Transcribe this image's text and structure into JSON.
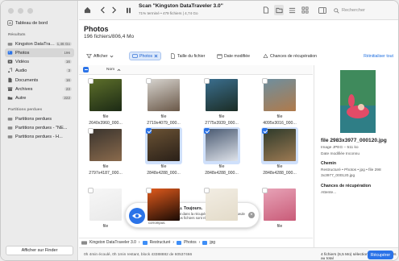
{
  "sidebar": {
    "dashboard_label": "Tableau de bord",
    "results_heading": "Résultats",
    "results": [
      {
        "label": "Kingston DataTraveler...",
        "count": "1,46 Go"
      },
      {
        "label": "Photos",
        "count": "196"
      },
      {
        "label": "Vidéos",
        "count": "16"
      },
      {
        "label": "Audio",
        "count": "3"
      },
      {
        "label": "Documents",
        "count": "16"
      },
      {
        "label": "Archives",
        "count": "23"
      },
      {
        "label": "Autre",
        "count": "222"
      }
    ],
    "lost_heading": "Partitions perdues",
    "lost": [
      {
        "label": "Partitions perdues"
      },
      {
        "label": "Partitions perdues - \"NE..."
      },
      {
        "label": "Partitions perdues - H..."
      }
    ],
    "finder_button": "Afficher sur Finder"
  },
  "toolbar": {
    "scan_title": "Scan \"Kingston DataTraveler 3.0\"",
    "scan_sub": "71% terminé • 479 fichiers | 4,74 Go",
    "search_placeholder": "Rechercher"
  },
  "header": {
    "title": "Photos",
    "subtitle": "196 fichiers/806,4 Mo"
  },
  "filters": {
    "show": "Afficher",
    "photos": "Photos",
    "file_size": "Taille du fichier",
    "date_modified": "Date modifiée",
    "recovery_chances": "Chances de récupération",
    "reset": "Réinitialiser tout"
  },
  "list": {
    "name_col": "Nom"
  },
  "grid": {
    "tiles": [
      {
        "line1": "",
        "line2": "file 2640x3960_000...",
        "checked": false,
        "selected": false,
        "focus": false,
        "c1": "#5d6f2a",
        "c2": "#1c2a15"
      },
      {
        "line1": "",
        "line2": "file 2719x4079_000...",
        "checked": false,
        "selected": false,
        "focus": false,
        "c1": "#d7d4cf",
        "c2": "#6a5848"
      },
      {
        "line1": "",
        "line2": "file 2775x3939_000...",
        "checked": false,
        "selected": false,
        "focus": false,
        "c1": "#3b6f8f",
        "c2": "#1b2c24"
      },
      {
        "line1": "",
        "line2": "file 4095x3016_000...",
        "checked": false,
        "selected": false,
        "focus": false,
        "c1": "#6e8f9f",
        "c2": "#b07a4a"
      },
      {
        "line1": "",
        "line2": "file 2797x4187_000...",
        "checked": false,
        "selected": false,
        "focus": false,
        "c1": "#3a342e",
        "c2": "#8a6a4c"
      },
      {
        "line1": "",
        "line2": "file 2848x4288_000...",
        "checked": true,
        "selected": true,
        "focus": false,
        "c1": "#6a5234",
        "c2": "#2a2018"
      },
      {
        "line1": "",
        "line2": "file 2848x4288_000...",
        "checked": true,
        "selected": true,
        "focus": false,
        "c1": "#4a5a72",
        "c2": "#dfe3ea"
      },
      {
        "line1": "",
        "line2": "file 2848x4288_000...",
        "checked": true,
        "selected": true,
        "focus": false,
        "c1": "#2e3a2a",
        "c2": "#9d7a53"
      },
      {
        "line1": "",
        "line2": "file",
        "checked": false,
        "selected": false,
        "focus": false,
        "c1": "#f7f7f7",
        "c2": "#e9e9e9"
      },
      {
        "line1": "",
        "line2": "file",
        "checked": false,
        "selected": false,
        "focus": false,
        "c1": "#e05a1c",
        "c2": "#1a0b05"
      },
      {
        "line1": "",
        "line2": "file",
        "checked": false,
        "selected": false,
        "focus": false,
        "c1": "#f2ede3",
        "c2": "#e3dbc9"
      },
      {
        "line1": "",
        "line2": "file",
        "checked": false,
        "selected": false,
        "focus": false,
        "c1": "#e7a3b7",
        "c2": "#c95b78"
      },
      {
        "line1": "",
        "line2": "file",
        "checked": true,
        "selected": true,
        "focus": true,
        "c1": "#4f9e6f",
        "c2": "#e2506a"
      }
    ]
  },
  "tip": {
    "title": "Conseil : Aperçu. Toujours.",
    "body": "Aperçu très important dans la récupération. Aperçu est la seule façon de vérifier si vos fichiers sont récupérables et non corrompus."
  },
  "path": {
    "items": [
      "Kingston DataTraveler 3.0",
      "Restructuré",
      "Photos",
      "jpg"
    ]
  },
  "status": {
    "left": "0h 4min écoulé, 0h 1min restant, block 43388882 de 60537466",
    "right": "4 fichiers (6,5 Mo) sélectionnés, 479 fichiers au total",
    "recover_label": "Récupérer"
  },
  "preview": {
    "file_name": "file 2983x3977_000120.jpg",
    "kind": "Image JPEG – 511 ko",
    "date_modified": "Date modifiée Inconnu",
    "path_heading": "Chemin",
    "path_value": "Restructuré • Photos • jpg • file 298 3x3977_000120.jpg",
    "chances_heading": "Chances de récupération",
    "chances_value": "Attente..."
  },
  "colors": {
    "accent": "#2b73e8",
    "selection": "#cfe0fb"
  }
}
